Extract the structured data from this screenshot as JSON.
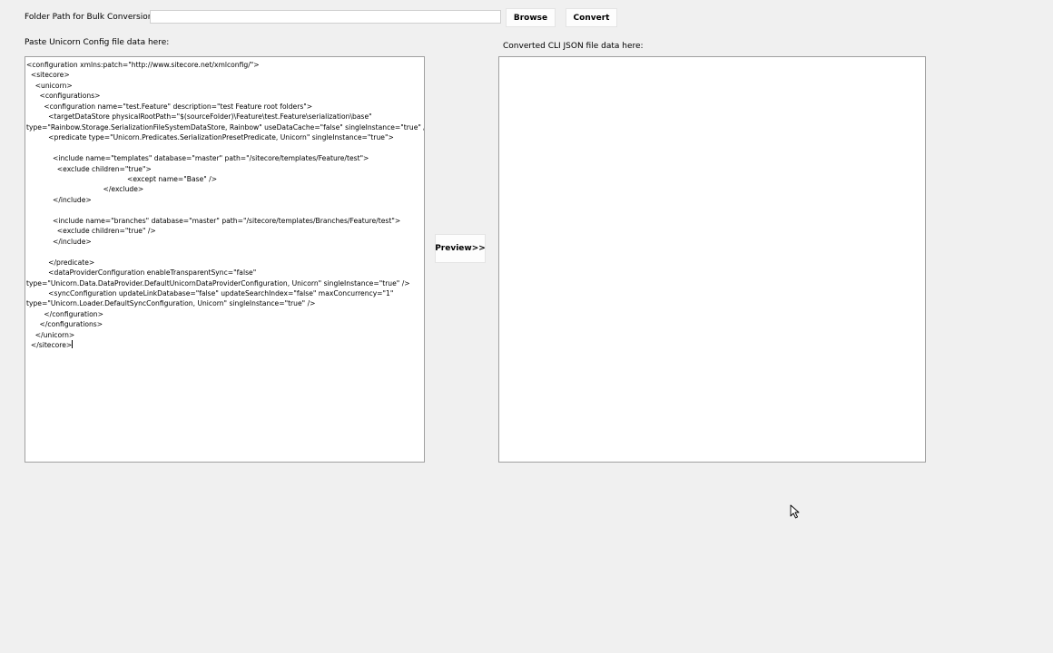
{
  "folder": {
    "label": "Folder Path for Bulk Conversion:",
    "value": "",
    "placeholder": ""
  },
  "buttons": {
    "browse": "Browse",
    "convert": "Convert",
    "preview": "Preview>>"
  },
  "source": {
    "label": "Paste Unicorn Config file data here:",
    "content": "<configuration xmlns:patch=\"http://www.sitecore.net/xmlconfig/\">\n  <sitecore>\n    <unicorn>\n      <configurations>\n        <configuration name=\"test.Feature\" description=\"test Feature root folders\">\n          <targetDataStore physicalRootPath=\"$(sourceFolder)\\Feature\\test.Feature\\serialization\\base\"\ntype=\"Rainbow.Storage.SerializationFileSystemDataStore, Rainbow\" useDataCache=\"false\" singleInstance=\"true\" />\n          <predicate type=\"Unicorn.Predicates.SerializationPresetPredicate, Unicorn\" singleInstance=\"true\">\n\n            <include name=\"templates\" database=\"master\" path=\"/sitecore/templates/Feature/test\">\n              <exclude children=\"true\">\n                                              <except name=\"Base\" />\n                                   </exclude>\n            </include>\n\n            <include name=\"branches\" database=\"master\" path=\"/sitecore/templates/Branches/Feature/test\">\n              <exclude children=\"true\" />\n            </include>\n\n          </predicate>\n          <dataProviderConfiguration enableTransparentSync=\"false\"\ntype=\"Unicorn.Data.DataProvider.DefaultUnicornDataProviderConfiguration, Unicorn\" singleInstance=\"true\" />\n          <syncConfiguration updateLinkDatabase=\"false\" updateSearchIndex=\"false\" maxConcurrency=\"1\"\ntype=\"Unicorn.Loader.DefaultSyncConfiguration, Unicorn\" singleInstance=\"true\" />\n        </configuration>\n      </configurations>\n    </unicorn>\n  </sitecore>"
  },
  "output": {
    "label": "Converted CLI JSON file data here:",
    "content": ""
  },
  "icons": {
    "cursor": "mouse-pointer-icon"
  },
  "colors": {
    "window_bg": "#f0f0f0",
    "textbox_bg": "#ffffff",
    "textbox_border": "#a0a0a0"
  }
}
